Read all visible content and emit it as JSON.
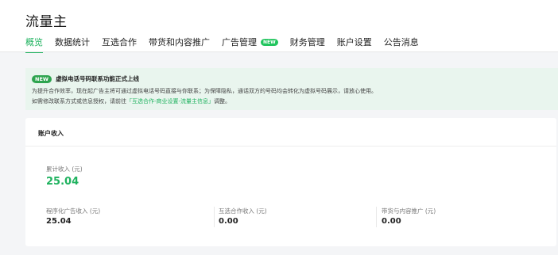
{
  "header": {
    "title": "流量主"
  },
  "tabs": [
    {
      "label": "概览",
      "active": true
    },
    {
      "label": "数据统计",
      "active": false
    },
    {
      "label": "互选合作",
      "active": false
    },
    {
      "label": "带货和内容推广",
      "active": false
    },
    {
      "label": "广告管理",
      "active": false,
      "badge": "NEW"
    },
    {
      "label": "财务管理",
      "active": false
    },
    {
      "label": "账户设置",
      "active": false
    },
    {
      "label": "公告消息",
      "active": false
    }
  ],
  "notice": {
    "badge": "NEW",
    "title": "虚拟电话号码联系功能正式上线",
    "line1": "为提升合作效率，现在起广告主将可通过虚拟电话号码直接与你联系；为保障隐私，通话双方的号码均会转化为虚拟号码展示，请放心使用。",
    "line2_prefix": "如需修改联系方式或信息授权，请前往",
    "line2_link": "「互选合作-商业设置-流量主信息」",
    "line2_suffix": "调整。"
  },
  "account_income": {
    "title": "账户收入",
    "total": {
      "label": "累计收入 (元)",
      "value": "25.04"
    },
    "items": [
      {
        "label": "程序化广告收入 (元)",
        "value": "25.04"
      },
      {
        "label": "互选合作收入 (元)",
        "value": "0.00"
      },
      {
        "label": "带货与内容推广 (元)",
        "value": "0.00"
      }
    ]
  },
  "colors": {
    "accent": "#1fb25f",
    "notice_bg": "#e9f5ee",
    "page_bg": "#f4f5f7"
  }
}
